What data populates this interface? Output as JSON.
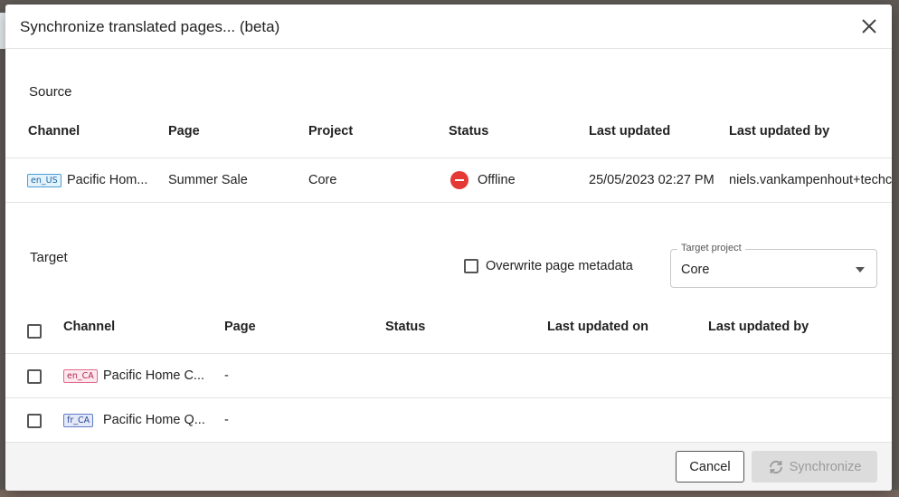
{
  "dialog": {
    "title": "Synchronize translated pages... (beta)"
  },
  "source": {
    "section_label": "Source",
    "columns": [
      "Channel",
      "Page",
      "Project",
      "Status",
      "Last updated",
      "Last updated by"
    ],
    "row": {
      "channel_badge": "en_US",
      "channel": "Pacific Hom...",
      "page": "Summer Sale",
      "project": "Core",
      "status": "Offline",
      "last_updated": "25/05/2023 02:27 PM",
      "last_updated_by": "niels.vankampenhout+techco"
    }
  },
  "target": {
    "section_label": "Target",
    "overwrite_label": "Overwrite page metadata",
    "target_project_legend": "Target project",
    "target_project_value": "Core",
    "columns": [
      "Channel",
      "Page",
      "Status",
      "Last updated on",
      "Last updated by"
    ],
    "rows": [
      {
        "channel_badge": "en_CA",
        "channel": "Pacific Home C...",
        "page": "-"
      },
      {
        "channel_badge": "fr_CA",
        "channel": "Pacific Home Q...",
        "page": "-"
      }
    ]
  },
  "footer": {
    "cancel_label": "Cancel",
    "sync_label": "Synchronize"
  },
  "colors": {
    "status_offline": "#e53935",
    "badge_en_US": "#4a9fd6",
    "badge_en_CA": "#e06a8c",
    "badge_fr_CA": "#5f7cc7"
  }
}
